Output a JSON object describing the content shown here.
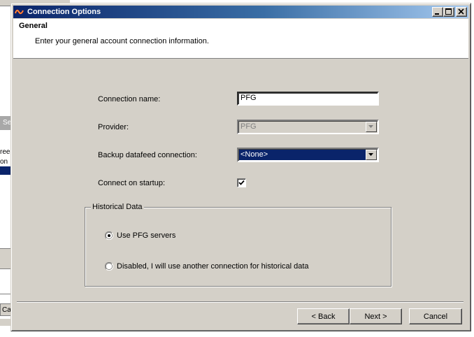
{
  "background": {
    "partial_button_label": "Se",
    "partial_text_1": "ree",
    "partial_text_2": "on",
    "partial_cancel_label": "Ca"
  },
  "window": {
    "title": "Connection Options",
    "minimize_icon": "minimize-icon",
    "maximize_icon": "maximize-icon",
    "close_icon": "close-icon"
  },
  "header": {
    "title": "General",
    "subtitle": "Enter your general account connection information."
  },
  "form": {
    "connection_name_label": "Connection name:",
    "connection_name_value": "PFG",
    "provider_label": "Provider:",
    "provider_value": "PFG",
    "backup_label": "Backup datafeed connection:",
    "backup_value": "<None>",
    "startup_label": "Connect on startup:",
    "startup_checked": true
  },
  "historical": {
    "group_label": "Historical Data",
    "option_pfg": "Use PFG servers",
    "option_disabled": "Disabled, I will use another connection for historical data",
    "selected": "option_pfg"
  },
  "buttons": {
    "back": "< Back",
    "next": "Next >",
    "cancel": "Cancel"
  },
  "colors": {
    "face": "#d4d0c8",
    "selection": "#0a246a",
    "title_start": "#0a246a",
    "title_end": "#a6caf0"
  }
}
